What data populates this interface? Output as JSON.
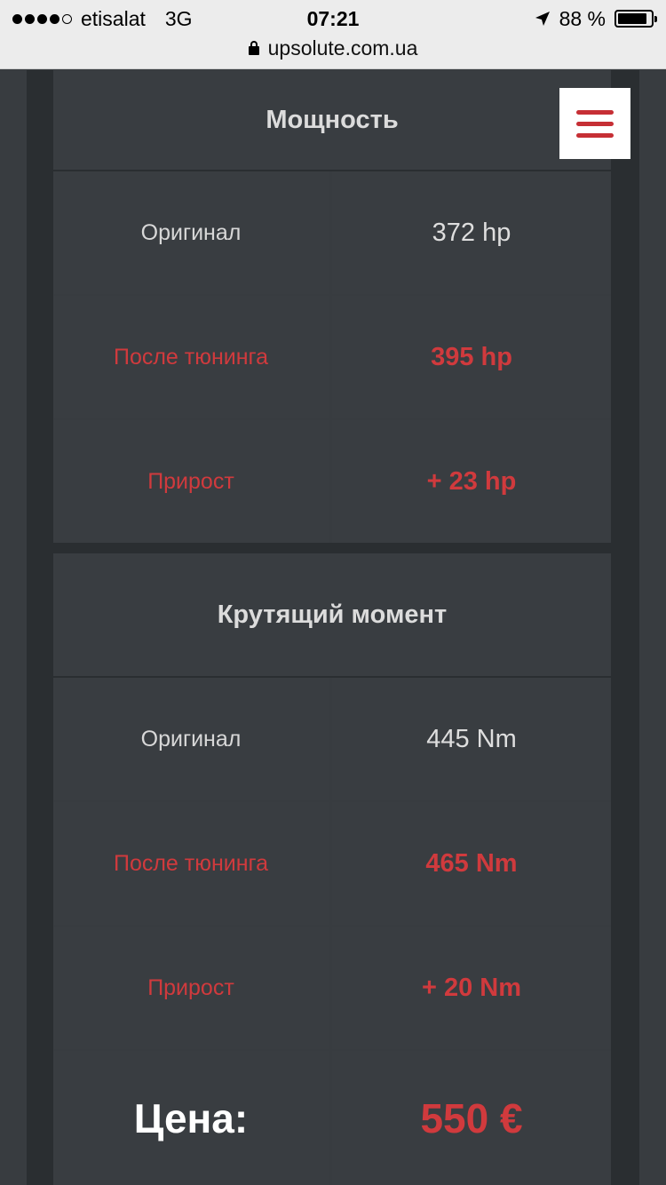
{
  "status_bar": {
    "signal_dots": 5,
    "signal_filled": 4,
    "carrier": "etisalat",
    "network": "3G",
    "time": "07:21",
    "battery_percent": "88 %",
    "battery_level": 0.88,
    "location_icon": "location-arrow-icon"
  },
  "address_bar": {
    "url": "upsolute.com.ua",
    "lock_icon": "lock-icon"
  },
  "menu": {
    "icon": "hamburger-menu-icon",
    "color": "#c62f35"
  },
  "power": {
    "title": "Мощность",
    "original_label": "Оригинал",
    "original_value": "372 hp",
    "tuned_label": "После тюнинга",
    "tuned_value": "395 hp",
    "gain_label": "Прирост",
    "gain_value": "+ 23 hp"
  },
  "torque": {
    "title": "Крутящий момент",
    "original_label": "Оригинал",
    "original_value": "445 Nm",
    "tuned_label": "После тюнинга",
    "tuned_value": "465 Nm",
    "gain_label": "Прирост",
    "gain_value": "+ 20 Nm"
  },
  "price": {
    "label": "Цена:",
    "value": "550 €"
  },
  "colors": {
    "accent": "#d03a3d",
    "background": "#383c40",
    "rail": "#2a2e31"
  }
}
